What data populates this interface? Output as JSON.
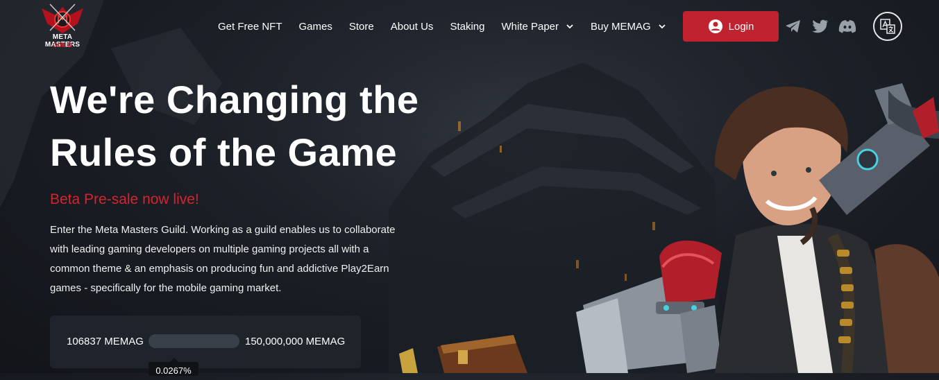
{
  "brand": {
    "name_line1": "META MASTERS",
    "name_line2": "GUILD",
    "accent": "#c1222f"
  },
  "nav": {
    "items": [
      {
        "label": "Get Free NFT"
      },
      {
        "label": "Games"
      },
      {
        "label": "Store"
      },
      {
        "label": "About Us"
      },
      {
        "label": "Staking"
      },
      {
        "label": "White Paper",
        "icon": "chevron-down-icon"
      },
      {
        "label": "Buy MEMAG",
        "icon": "chevron-down-icon"
      }
    ],
    "login_label": "Login",
    "socials": [
      "telegram-icon",
      "twitter-icon",
      "discord-icon"
    ],
    "language_icon": "translate-icon"
  },
  "hero": {
    "title": "We're Changing the Rules of the Game",
    "subtitle": "Beta Pre-sale now live!",
    "description": "Enter the Meta Masters Guild. Working as a guild enables us to collaborate with leading gaming developers on multiple gaming projects all with a common theme & an emphasis on producing fun and addictive Play2Earn games - specifically for the mobile gaming market.",
    "subtitle_color": "#d4252f"
  },
  "presale": {
    "raised": "106837 MEMAG",
    "goal": "150,000,000 MEMAG",
    "percent_label": "0.0267%",
    "percent_value": 0.0267
  }
}
